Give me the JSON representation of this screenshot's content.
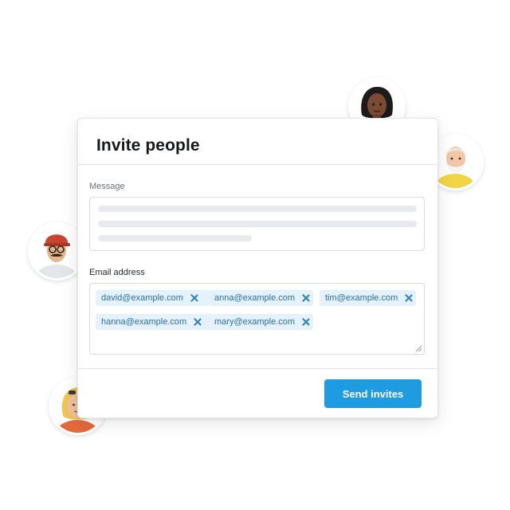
{
  "dialog": {
    "title": "Invite people",
    "message_label": "Message",
    "email_label": "Email address",
    "emails": [
      "david@example.com",
      "anna@example.com",
      "tim@example.com",
      "hanna@example.com",
      "mary@example.com"
    ],
    "send_label": "Send invites"
  },
  "colors": {
    "accent": "#1f9be2",
    "chip_bg": "#e6f2fb",
    "chip_text": "#2a6f9e"
  },
  "icons": {
    "remove_chip": "close-icon"
  }
}
